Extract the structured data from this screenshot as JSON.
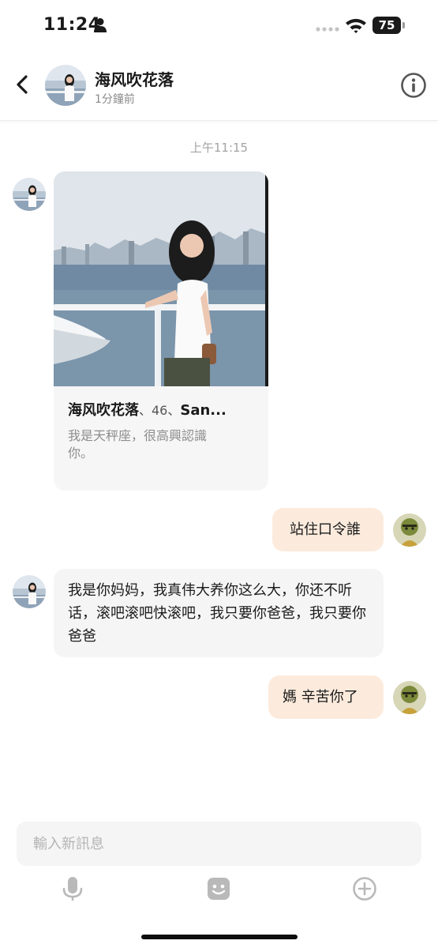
{
  "status_bar": {
    "time": "11:24",
    "battery": "75"
  },
  "header": {
    "name": "海风吹花落",
    "last_seen": "1分鐘前"
  },
  "timestamp": "上午11:15",
  "profile_card": {
    "name": "海风吹花落",
    "meta": "、46、",
    "location": "San...",
    "description": "我是天秤座，很高興認識你。"
  },
  "messages": [
    {
      "direction": "out",
      "text": "站住口令誰"
    },
    {
      "direction": "in",
      "text": "我是你妈妈，我真伟大养你这么大，你还不听话，滚吧滚吧快滚吧，我只要你爸爸，我只要你爸爸"
    },
    {
      "direction": "out",
      "text": "媽 辛苦你了"
    }
  ],
  "composer": {
    "placeholder": "輸入新訊息"
  },
  "icons": {
    "back": "chevron-left-icon",
    "info": "info-icon",
    "mic": "microphone-icon",
    "sticker": "sticker-face-icon",
    "add": "plus-circle-icon"
  },
  "colors": {
    "outgoing_bubble": "#fcebdd",
    "incoming_bubble": "#f5f5f5",
    "muted_text": "#8a8a8a",
    "tool_icon": "#b9b9b9"
  }
}
